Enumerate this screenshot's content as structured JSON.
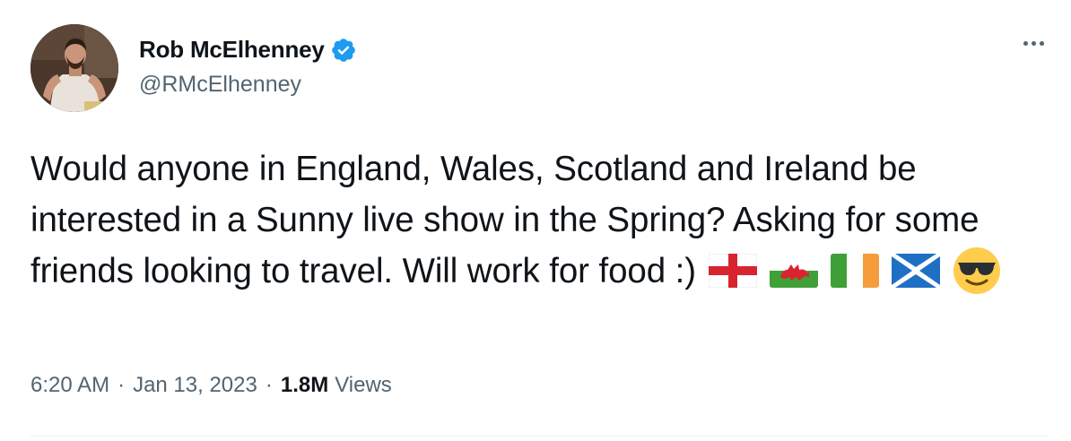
{
  "author": {
    "display_name": "Rob McElhenney",
    "handle": "@RMcElhenney",
    "verified": true
  },
  "tweet": {
    "text": "Would anyone in England, Wales, Scotland and Ireland be interested in a Sunny live show in the Spring? Asking for some friends looking to travel. Will work for food :)",
    "emojis": [
      "flag-england-icon",
      "flag-wales-icon",
      "flag-ireland-icon",
      "flag-scotland-icon",
      "smiling-face-with-sunglasses-icon"
    ]
  },
  "meta": {
    "time": "6:20 AM",
    "separator": "·",
    "date": "Jan 13, 2023",
    "views_count": "1.8M",
    "views_label": "Views"
  },
  "colors": {
    "text": "#0f1419",
    "secondary": "#536471",
    "verified": "#1d9bf0",
    "divider": "#eff3f4"
  }
}
